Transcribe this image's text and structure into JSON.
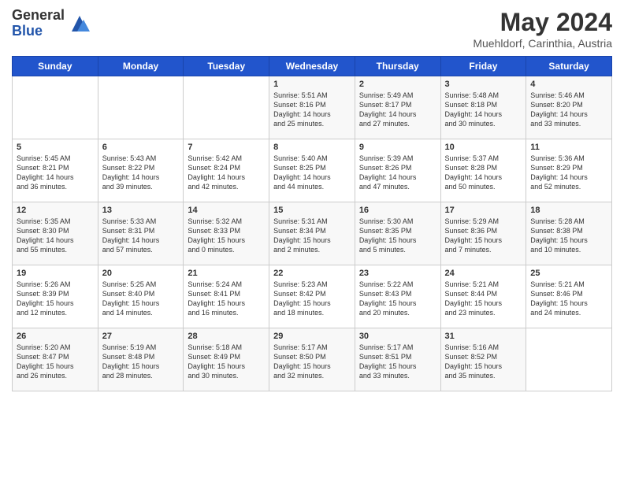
{
  "logo": {
    "general": "General",
    "blue": "Blue"
  },
  "title": "May 2024",
  "subtitle": "Muehldorf, Carinthia, Austria",
  "header_days": [
    "Sunday",
    "Monday",
    "Tuesday",
    "Wednesday",
    "Thursday",
    "Friday",
    "Saturday"
  ],
  "weeks": [
    [
      {
        "day": "",
        "content": ""
      },
      {
        "day": "",
        "content": ""
      },
      {
        "day": "",
        "content": ""
      },
      {
        "day": "1",
        "content": "Sunrise: 5:51 AM\nSunset: 8:16 PM\nDaylight: 14 hours\nand 25 minutes."
      },
      {
        "day": "2",
        "content": "Sunrise: 5:49 AM\nSunset: 8:17 PM\nDaylight: 14 hours\nand 27 minutes."
      },
      {
        "day": "3",
        "content": "Sunrise: 5:48 AM\nSunset: 8:18 PM\nDaylight: 14 hours\nand 30 minutes."
      },
      {
        "day": "4",
        "content": "Sunrise: 5:46 AM\nSunset: 8:20 PM\nDaylight: 14 hours\nand 33 minutes."
      }
    ],
    [
      {
        "day": "5",
        "content": "Sunrise: 5:45 AM\nSunset: 8:21 PM\nDaylight: 14 hours\nand 36 minutes."
      },
      {
        "day": "6",
        "content": "Sunrise: 5:43 AM\nSunset: 8:22 PM\nDaylight: 14 hours\nand 39 minutes."
      },
      {
        "day": "7",
        "content": "Sunrise: 5:42 AM\nSunset: 8:24 PM\nDaylight: 14 hours\nand 42 minutes."
      },
      {
        "day": "8",
        "content": "Sunrise: 5:40 AM\nSunset: 8:25 PM\nDaylight: 14 hours\nand 44 minutes."
      },
      {
        "day": "9",
        "content": "Sunrise: 5:39 AM\nSunset: 8:26 PM\nDaylight: 14 hours\nand 47 minutes."
      },
      {
        "day": "10",
        "content": "Sunrise: 5:37 AM\nSunset: 8:28 PM\nDaylight: 14 hours\nand 50 minutes."
      },
      {
        "day": "11",
        "content": "Sunrise: 5:36 AM\nSunset: 8:29 PM\nDaylight: 14 hours\nand 52 minutes."
      }
    ],
    [
      {
        "day": "12",
        "content": "Sunrise: 5:35 AM\nSunset: 8:30 PM\nDaylight: 14 hours\nand 55 minutes."
      },
      {
        "day": "13",
        "content": "Sunrise: 5:33 AM\nSunset: 8:31 PM\nDaylight: 14 hours\nand 57 minutes."
      },
      {
        "day": "14",
        "content": "Sunrise: 5:32 AM\nSunset: 8:33 PM\nDaylight: 15 hours\nand 0 minutes."
      },
      {
        "day": "15",
        "content": "Sunrise: 5:31 AM\nSunset: 8:34 PM\nDaylight: 15 hours\nand 2 minutes."
      },
      {
        "day": "16",
        "content": "Sunrise: 5:30 AM\nSunset: 8:35 PM\nDaylight: 15 hours\nand 5 minutes."
      },
      {
        "day": "17",
        "content": "Sunrise: 5:29 AM\nSunset: 8:36 PM\nDaylight: 15 hours\nand 7 minutes."
      },
      {
        "day": "18",
        "content": "Sunrise: 5:28 AM\nSunset: 8:38 PM\nDaylight: 15 hours\nand 10 minutes."
      }
    ],
    [
      {
        "day": "19",
        "content": "Sunrise: 5:26 AM\nSunset: 8:39 PM\nDaylight: 15 hours\nand 12 minutes."
      },
      {
        "day": "20",
        "content": "Sunrise: 5:25 AM\nSunset: 8:40 PM\nDaylight: 15 hours\nand 14 minutes."
      },
      {
        "day": "21",
        "content": "Sunrise: 5:24 AM\nSunset: 8:41 PM\nDaylight: 15 hours\nand 16 minutes."
      },
      {
        "day": "22",
        "content": "Sunrise: 5:23 AM\nSunset: 8:42 PM\nDaylight: 15 hours\nand 18 minutes."
      },
      {
        "day": "23",
        "content": "Sunrise: 5:22 AM\nSunset: 8:43 PM\nDaylight: 15 hours\nand 20 minutes."
      },
      {
        "day": "24",
        "content": "Sunrise: 5:21 AM\nSunset: 8:44 PM\nDaylight: 15 hours\nand 23 minutes."
      },
      {
        "day": "25",
        "content": "Sunrise: 5:21 AM\nSunset: 8:46 PM\nDaylight: 15 hours\nand 24 minutes."
      }
    ],
    [
      {
        "day": "26",
        "content": "Sunrise: 5:20 AM\nSunset: 8:47 PM\nDaylight: 15 hours\nand 26 minutes."
      },
      {
        "day": "27",
        "content": "Sunrise: 5:19 AM\nSunset: 8:48 PM\nDaylight: 15 hours\nand 28 minutes."
      },
      {
        "day": "28",
        "content": "Sunrise: 5:18 AM\nSunset: 8:49 PM\nDaylight: 15 hours\nand 30 minutes."
      },
      {
        "day": "29",
        "content": "Sunrise: 5:17 AM\nSunset: 8:50 PM\nDaylight: 15 hours\nand 32 minutes."
      },
      {
        "day": "30",
        "content": "Sunrise: 5:17 AM\nSunset: 8:51 PM\nDaylight: 15 hours\nand 33 minutes."
      },
      {
        "day": "31",
        "content": "Sunrise: 5:16 AM\nSunset: 8:52 PM\nDaylight: 15 hours\nand 35 minutes."
      },
      {
        "day": "",
        "content": ""
      }
    ]
  ]
}
